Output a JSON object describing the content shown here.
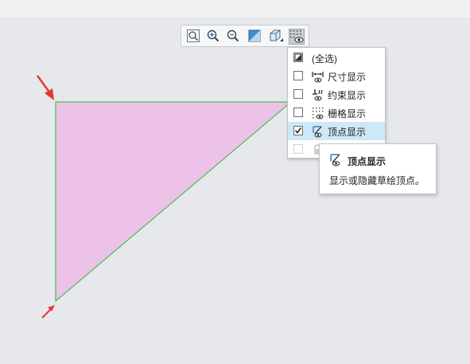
{
  "toolbar": {
    "buttons": [
      {
        "name": "zoom-fit",
        "icon": "zoom-fit-icon"
      },
      {
        "name": "zoom-in",
        "icon": "zoom-in-icon"
      },
      {
        "name": "zoom-out",
        "icon": "zoom-out-icon"
      },
      {
        "name": "display-style",
        "icon": "display-style-icon"
      },
      {
        "name": "view-orientation",
        "icon": "view-cube-icon"
      },
      {
        "name": "sketch-display-filter",
        "icon": "sketch-display-filter-icon",
        "active": true
      }
    ]
  },
  "menu": {
    "items": [
      {
        "label": "(全选)",
        "checked": "partial",
        "icon": "select-all-icon"
      },
      {
        "label": "尺寸显示",
        "checked": false,
        "icon": "dimension-display-icon"
      },
      {
        "label": "约束显示",
        "checked": false,
        "icon": "constraint-display-icon"
      },
      {
        "label": "栅格显示",
        "checked": false,
        "icon": "grid-display-icon"
      },
      {
        "label": "顶点显示",
        "checked": true,
        "icon": "vertex-display-icon",
        "highlighted": true
      },
      {
        "label": "",
        "checked": false,
        "icon": "lock-icon",
        "disabled": true
      }
    ]
  },
  "tooltip": {
    "title": "顶点显示",
    "description": "显示或隐藏草绘顶点。"
  },
  "colors": {
    "triangle_fill": "#ecc2e9",
    "triangle_edge": "#2fb52f",
    "arrow": "#e53935",
    "menu_highlight": "#cde8f6"
  }
}
